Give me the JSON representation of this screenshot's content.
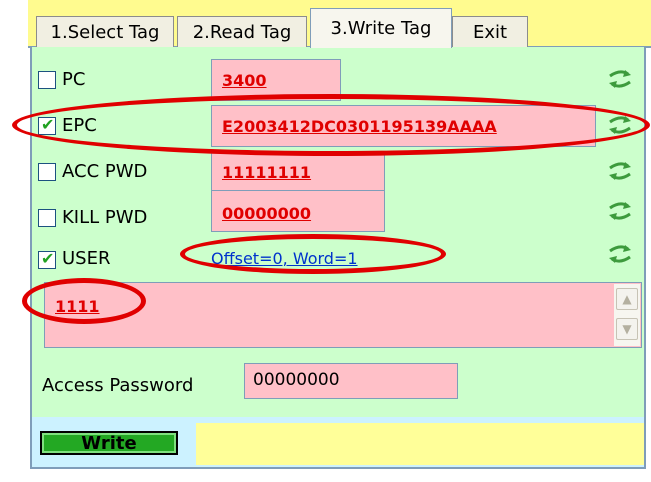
{
  "tabs": [
    {
      "label": "1.Select Tag",
      "active": false
    },
    {
      "label": "2.Read Tag",
      "active": false
    },
    {
      "label": "3.Write Tag",
      "active": true
    },
    {
      "label": "Exit",
      "active": false
    }
  ],
  "fields": {
    "pc": {
      "label": "PC",
      "checked": false,
      "value": "3400"
    },
    "epc": {
      "label": "EPC",
      "checked": true,
      "value": "E2003412DC0301195139AAAA"
    },
    "acc_pwd": {
      "label": "ACC PWD",
      "checked": false,
      "value": "11111111"
    },
    "kill_pwd": {
      "label": "KILL PWD",
      "checked": false,
      "value": "00000000"
    },
    "user": {
      "label": "USER",
      "checked": true,
      "link": "Offset=0, Word=1"
    }
  },
  "user_data": {
    "value": "1111"
  },
  "access_password": {
    "label": "Access Password",
    "value": "00000000"
  },
  "write_button": {
    "label": "Write"
  },
  "status": {
    "text": ""
  },
  "colors": {
    "panel_bg": "#ccffcc",
    "field_bg": "#ffc0c8",
    "value_text": "#e00000",
    "link_text": "#0033cc",
    "tabbar_bg": "#fffb8f",
    "status_bg": "#ffff99",
    "button_bg": "#23a823",
    "annotation": "#e00000"
  },
  "icons": {
    "refresh": "refresh-arrows-icon",
    "check": "checkmark-icon",
    "scroll_up": "chevron-up-icon",
    "scroll_down": "chevron-down-icon"
  }
}
